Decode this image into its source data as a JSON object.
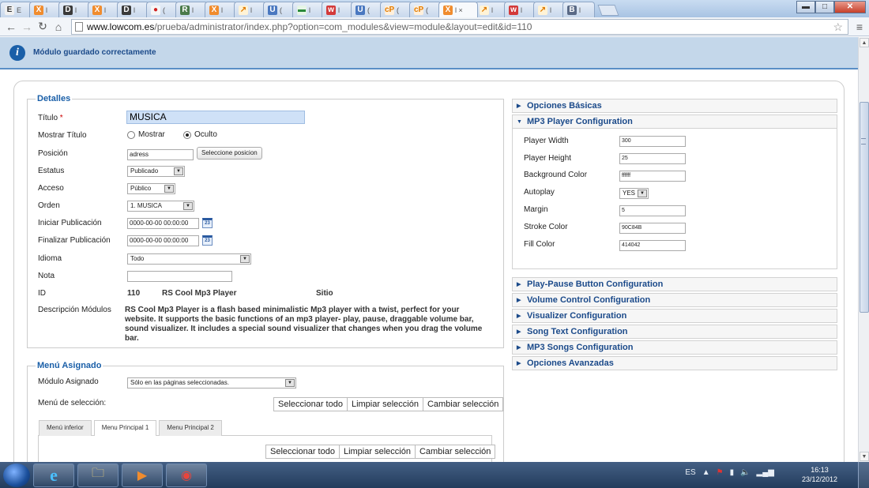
{
  "browser": {
    "tabs": [
      {
        "fav": "E",
        "label": "E",
        "color": "#333333",
        "bg": "#f0f0f0"
      },
      {
        "fav": "X",
        "label": "l",
        "color": "#ffffff",
        "bg": "#f08c2e"
      },
      {
        "fav": "D",
        "label": "l",
        "color": "#ffffff",
        "bg": "#3a3a3a"
      },
      {
        "fav": "X",
        "label": "l",
        "color": "#ffffff",
        "bg": "#f08c2e"
      },
      {
        "fav": "D",
        "label": "l",
        "color": "#ffffff",
        "bg": "#3a3a3a"
      },
      {
        "fav": "●",
        "label": "(",
        "color": "#d02020",
        "bg": "#f6f6f6"
      },
      {
        "fav": "R",
        "label": "l",
        "color": "#ffffff",
        "bg": "#4a7a4a"
      },
      {
        "fav": "X",
        "label": "l",
        "color": "#ffffff",
        "bg": "#f08c2e"
      },
      {
        "fav": "↗",
        "label": "l",
        "color": "#e07a00",
        "bg": "#fff3d6"
      },
      {
        "fav": "U",
        "label": "(",
        "color": "#ffffff",
        "bg": "#4a78c0"
      },
      {
        "fav": "▬",
        "label": "l",
        "color": "#2a8a3a",
        "bg": "#e6f5e6"
      },
      {
        "fav": "w",
        "label": "l",
        "color": "#ffffff",
        "bg": "#d33a3a"
      },
      {
        "fav": "U",
        "label": "(",
        "color": "#ffffff",
        "bg": "#4a78c0"
      },
      {
        "fav": "cP",
        "label": "(",
        "color": "#e07a00",
        "bg": "#fff0dc"
      },
      {
        "fav": "cP",
        "label": "(",
        "color": "#e07a00",
        "bg": "#fff0dc"
      },
      {
        "fav": "X",
        "label": "l ×",
        "color": "#ffffff",
        "bg": "#f08c2e",
        "active": true
      },
      {
        "fav": "↗",
        "label": "l",
        "color": "#e07a00",
        "bg": "#fff3d6"
      },
      {
        "fav": "w",
        "label": "l",
        "color": "#ffffff",
        "bg": "#d33a3a"
      },
      {
        "fav": "↗",
        "label": "l",
        "color": "#e07a00",
        "bg": "#fff3d6"
      },
      {
        "fav": "B",
        "label": "l",
        "color": "#ffffff",
        "bg": "#5a6a86"
      }
    ],
    "url_domain": "www.lowcom.es",
    "url_path": "/prueba/administrator/index.php?option=com_modules&view=module&layout=edit&id=110",
    "window_controls": {
      "minimize": "▬",
      "maximize": "□",
      "close": "✕"
    }
  },
  "message": "Módulo guardado correctamente",
  "details": {
    "legend": "Detalles",
    "title_label": "Título",
    "required_mark": "*",
    "title_value": "MUSICA",
    "show_title_label": "Mostrar Título",
    "show_option": "Mostrar",
    "hide_option": "Oculto",
    "position_label": "Posición",
    "position_value": "adress",
    "select_position_button": "Seleccione posicion",
    "status_label": "Estatus",
    "status_value": "Publicado",
    "access_label": "Acceso",
    "access_value": "Público",
    "order_label": "Orden",
    "order_value": "1. MUSICA",
    "start_pub_label": "Iniciar Publicación",
    "start_pub_value": "0000-00-00 00:00:00",
    "end_pub_label": "Finalizar Publicación",
    "end_pub_value": "0000-00-00 00:00:00",
    "calendar_day": "23",
    "language_label": "Idioma",
    "language_value": "Todo",
    "note_label": "Nota",
    "note_value": "",
    "id_label": "ID",
    "id_value": "110",
    "module_name": "RS Cool Mp3 Player",
    "site_label": "Sitio",
    "desc_label": "Descripción Módulos",
    "desc_value": "RS Cool Mp3 Player is a flash based minimalistic Mp3 player with a twist, perfect for your website. It supports the basic functions of an mp3 player- play, pause, draggable volume bar, sound visualizer. It includes a special sound visualizer that changes when you drag the volume bar."
  },
  "menu_assignment": {
    "legend": "Menú Asignado",
    "module_assigned_label": "Módulo Asignado",
    "module_assigned_value": "Sólo en las páginas seleccionadas.",
    "menu_selection_label": "Menú de selección:",
    "select_all": "Seleccionar todo",
    "clear_selection": "Limpiar selección",
    "toggle_selection": "Cambiar selección",
    "tabs": [
      "Menú inferior",
      "Menu Principal 1",
      "Menu Principal 2"
    ],
    "active_tab": 1
  },
  "accordion": {
    "basic_options": "Opciones Básicas",
    "mp3_config": "MP3 Player Configuration",
    "fields": {
      "player_width_label": "Player Width",
      "player_width": "300",
      "player_height_label": "Player Height",
      "player_height": "25",
      "background_color_label": "Background Color",
      "background_color": "ffffff",
      "autoplay_label": "Autoplay",
      "autoplay": "YES",
      "margin_label": "Margin",
      "margin": "5",
      "stroke_color_label": "Stroke Color",
      "stroke_color": "90C84B",
      "fill_color_label": "Fill Color",
      "fill_color": "414042"
    },
    "sections": [
      "Play-Pause Button Configuration",
      "Volume Control Configuration",
      "Visualizer Configuration",
      "Song Text Configuration",
      "MP3 Songs Configuration",
      "Opciones Avanzadas"
    ]
  },
  "taskbar": {
    "language": "ES",
    "time": "16:13",
    "date": "23/12/2012",
    "tray_arrow": "▲",
    "apps": [
      "e",
      "🗀",
      "▶",
      "◉"
    ]
  },
  "colors": {
    "accent": "#1b4a8a",
    "message_bg": "#c4d7ea",
    "title_input_bg": "#cfe1f7"
  }
}
